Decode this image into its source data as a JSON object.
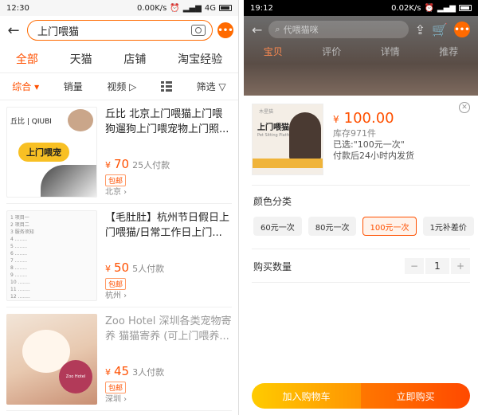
{
  "left": {
    "status": {
      "time": "12:30",
      "speed": "0.00K/s",
      "network": "4G"
    },
    "search": {
      "query": "上门喂猫"
    },
    "more_badge": "•••",
    "tabs": [
      "全部",
      "天猫",
      "店铺",
      "淘宝经验"
    ],
    "filters": {
      "sort": "综合",
      "sales": "销量",
      "video": "视频",
      "screen": "筛选"
    },
    "products": [
      {
        "title": "丘比 北京上门喂猫上门喂狗遛狗上门喂宠物上门照...",
        "yen": "¥",
        "price": "70",
        "sold": "25人付款",
        "tag": "包邮",
        "location": "北京",
        "img_brand": "丘比 | QIUBI",
        "img_text": "上门喂宠"
      },
      {
        "title": "【毛肚肚】杭州节日假日上门喂猫/日常工作日上门...",
        "yen": "¥",
        "price": "50",
        "sold": "5人付款",
        "tag": "包邮",
        "location": "杭州"
      },
      {
        "title": "Zoo Hotel 深圳各类宠物寄养 猫猫寄养 (可上门喂养...",
        "yen": "¥",
        "price": "45",
        "sold": "3人付款",
        "tag": "包邮",
        "location": "深圳"
      }
    ]
  },
  "right": {
    "status": {
      "time": "19:12",
      "speed": "0.02K/s"
    },
    "search": {
      "placeholder": "代喂猫咪"
    },
    "tabs": [
      "宝贝",
      "评价",
      "详情",
      "推荐"
    ],
    "sku": {
      "img_small": "木星猫",
      "img_title": "上门喂猫",
      "img_sub": "Pet Sitting Platform",
      "yen": "¥",
      "price": "100.00",
      "stock": "库存971件",
      "selected": "已选:\"100元一次\"",
      "ship": "付款后24小时内发货"
    },
    "color_title": "颜色分类",
    "options": [
      "60元一次",
      "80元一次",
      "100元一次",
      "1元补差价"
    ],
    "selected_option_index": 2,
    "qty_title": "购买数量",
    "qty": "1",
    "minus": "−",
    "plus": "+",
    "add_cart": "加入购物车",
    "buy_now": "立即购买",
    "accent": "#ff5000"
  }
}
